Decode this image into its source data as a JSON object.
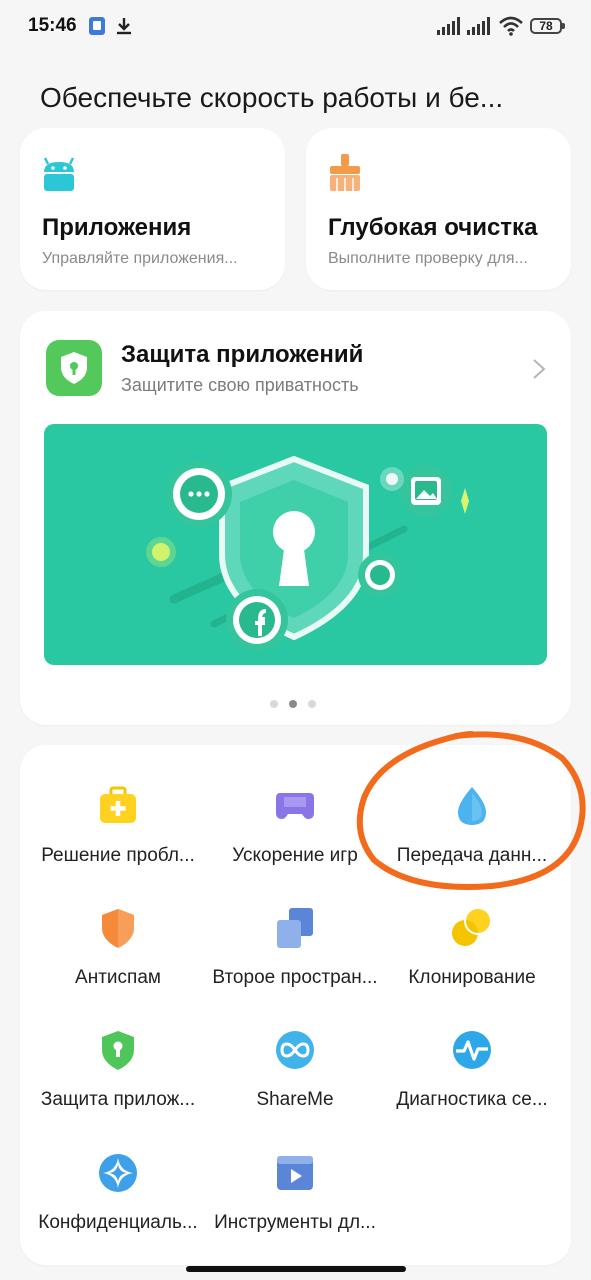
{
  "status_bar": {
    "time": "15:46",
    "battery": "78",
    "icons": [
      "sim-card-icon",
      "download-icon",
      "signal-1-icon",
      "signal-2-icon",
      "wifi-icon",
      "battery-icon"
    ]
  },
  "header": {
    "title": "Обеспечьте скорость работы и бе..."
  },
  "top_tiles": [
    {
      "title": "Приложения",
      "subtitle": "Управляйте приложения...",
      "icon": "android-icon"
    },
    {
      "title": "Глубокая очистка",
      "subtitle": "Выполните проверку для...",
      "icon": "broom-icon"
    }
  ],
  "feature_card": {
    "title": "Защита приложений",
    "subtitle": "Защитите свою приватность",
    "icon": "shield-lock-icon",
    "banner_color": "#2ac8a2",
    "carousel": {
      "count": 3,
      "active_index": 1
    }
  },
  "tools": [
    {
      "label": "Решение пробл...",
      "icon": "first-aid-kit-icon"
    },
    {
      "label": "Ускорение игр",
      "icon": "gamepad-icon"
    },
    {
      "label": "Передача данн...",
      "icon": "water-drop-icon"
    },
    {
      "label": "Антиспам",
      "icon": "orange-shield-icon"
    },
    {
      "label": "Второе простран...",
      "icon": "dual-space-icon"
    },
    {
      "label": "Клонирование",
      "icon": "clone-apps-icon"
    },
    {
      "label": "Защита прилож...",
      "icon": "app-lock-icon"
    },
    {
      "label": "ShareMe",
      "icon": "shareme-icon"
    },
    {
      "label": "Диагностика се...",
      "icon": "network-diagnostics-icon"
    },
    {
      "label": "Конфиденциаль...",
      "icon": "privacy-icon"
    },
    {
      "label": "Инструменты дл...",
      "icon": "video-tools-icon"
    }
  ],
  "colors": {
    "accent_green": "#2ac8a2",
    "annotation_orange": "#f26b1d",
    "background": "#f6f6f6"
  }
}
